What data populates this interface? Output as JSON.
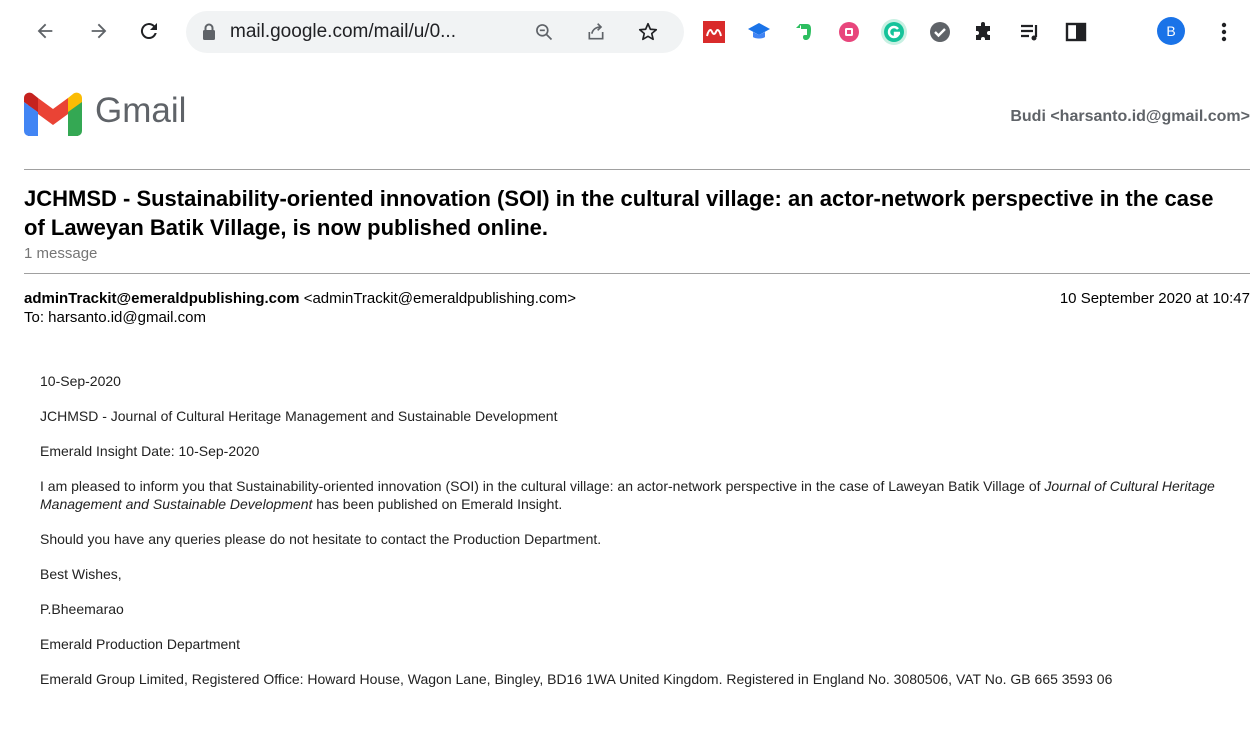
{
  "browser": {
    "url": "mail.google.com/mail/u/0...",
    "avatar_letter": "B"
  },
  "gmail": {
    "brand": "Gmail",
    "account": "Budi <harsanto.id@gmail.com>"
  },
  "thread": {
    "subject": "JCHMSD - Sustainability-oriented innovation (SOI) in the cultural village: an actor-network perspective in the case of Laweyan Batik Village, is now published online.",
    "count": "1 message",
    "from_name": "adminTrackit@emeraldpublishing.com",
    "from_email": "<adminTrackit@emeraldpublishing.com>",
    "to": "To: harsanto.id@gmail.com",
    "date": "10 September 2020 at 10:47"
  },
  "message": {
    "line_date": "10-Sep-2020",
    "journal": "JCHMSD - Journal of Cultural Heritage Management and Sustainable Development",
    "insight_date": "Emerald Insight Date: 10-Sep-2020",
    "inform_pre": "I am pleased to inform you that Sustainability-oriented innovation (SOI) in the cultural village: an actor-network perspective in the case of Laweyan Batik Village of ",
    "inform_journal": "Journal of Cultural Heritage Management and Sustainable Development",
    "inform_post": " has been published on Emerald Insight.",
    "queries": "Should you have any queries please do not hesitate to contact the Production Department.",
    "closing": "Best Wishes,",
    "signer": "P.Bheemarao",
    "department": "Emerald Production Department",
    "footer": "Emerald Group Limited, Registered Office: Howard House, Wagon Lane, Bingley, BD16 1WA United Kingdom. Registered in England No. 3080506, VAT No. GB 665 3593 06"
  },
  "icons": {
    "toolbar": [
      "back-arrow-icon",
      "forward-arrow-icon",
      "reload-icon",
      "lock-icon",
      "zoom-icon",
      "share-icon",
      "bookmark-star-icon"
    ],
    "extensions": [
      "mendeley-icon",
      "graduation-cap-icon",
      "evernote-icon",
      "record-icon",
      "grammarly-icon",
      "check-circle-icon",
      "puzzle-icon",
      "reading-list-icon",
      "side-panel-icon",
      "kebab-menu-icon"
    ]
  },
  "colors": {
    "accent": "#1a73e8",
    "grammarly": "#15c39a",
    "mendeley": "#d92b2b",
    "evernote": "#2dbe60",
    "record": "#e8467c"
  }
}
